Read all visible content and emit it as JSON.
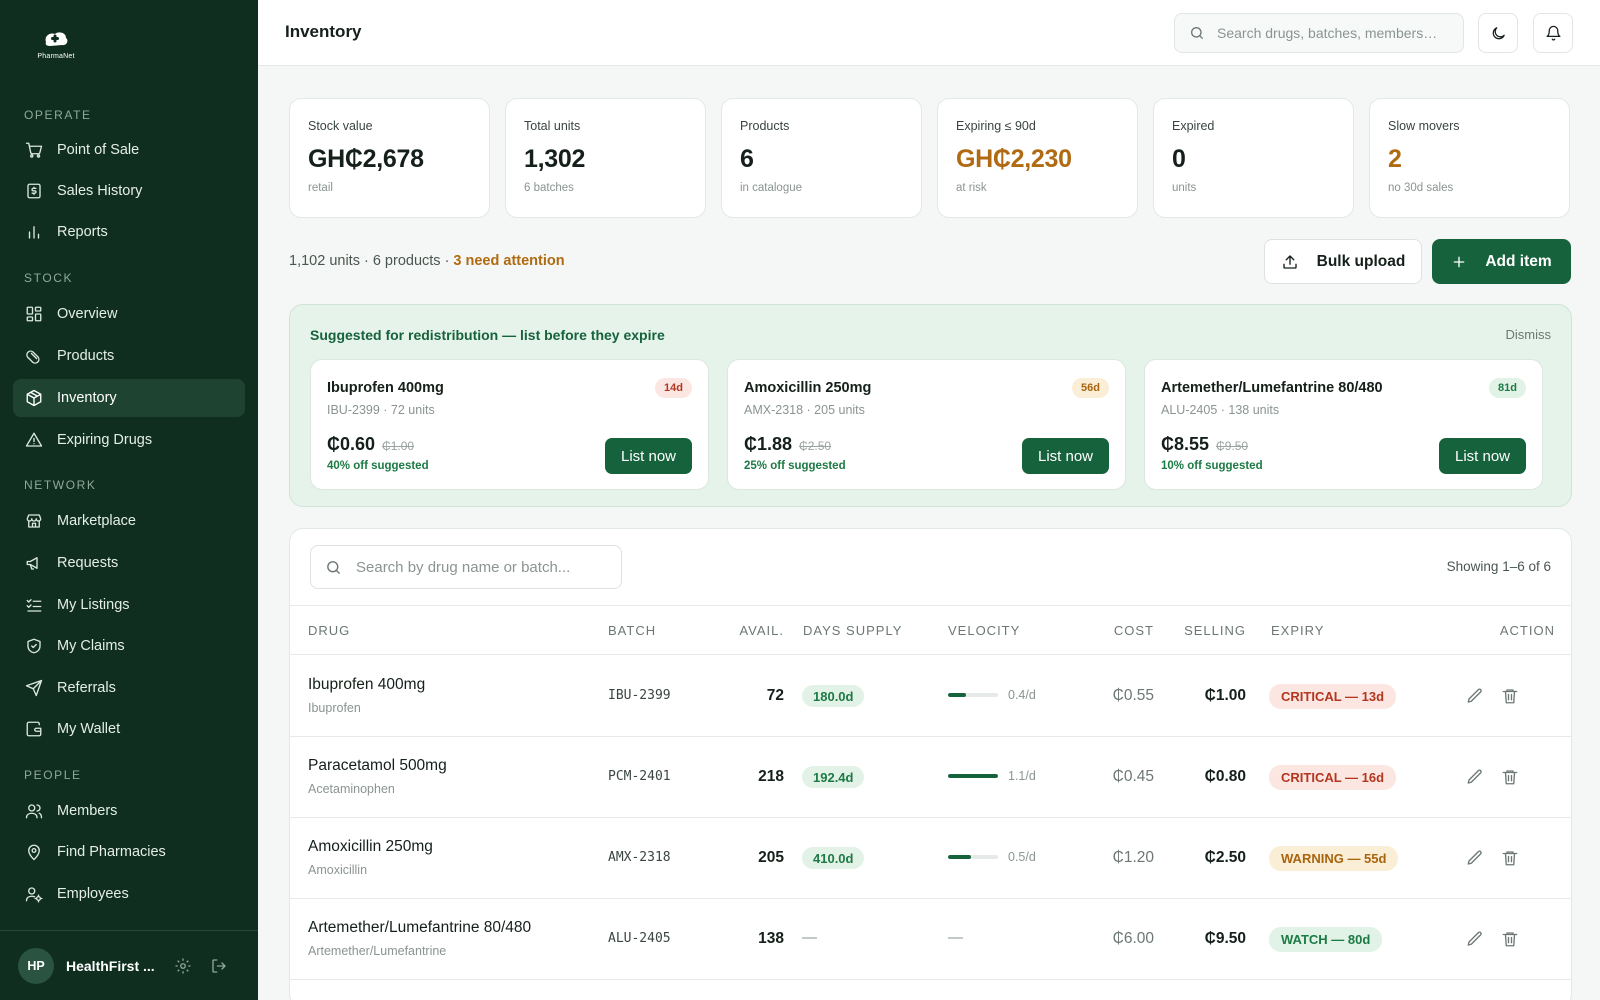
{
  "brand": {
    "name": "PharmaNet"
  },
  "sidebar": {
    "sections": {
      "operate": "OPERATE",
      "stock": "STOCK",
      "network": "NETWORK",
      "people": "PEOPLE"
    },
    "items": [
      {
        "label": "Point of Sale",
        "icon": "cart-icon"
      },
      {
        "label": "Sales History",
        "icon": "receipt-icon"
      },
      {
        "label": "Reports",
        "icon": "bar-chart-icon"
      },
      {
        "label": "Overview",
        "icon": "grid-icon"
      },
      {
        "label": "Products",
        "icon": "pill-icon"
      },
      {
        "label": "Inventory",
        "icon": "box-icon",
        "active": true
      },
      {
        "label": "Expiring Drugs",
        "icon": "warning-icon"
      },
      {
        "label": "Marketplace",
        "icon": "store-icon"
      },
      {
        "label": "Requests",
        "icon": "megaphone-icon"
      },
      {
        "label": "My Listings",
        "icon": "checklist-icon"
      },
      {
        "label": "My Claims",
        "icon": "shield-icon"
      },
      {
        "label": "Referrals",
        "icon": "send-icon"
      },
      {
        "label": "My Wallet",
        "icon": "wallet-icon"
      },
      {
        "label": "Members",
        "icon": "users-icon"
      },
      {
        "label": "Find Pharmacies",
        "icon": "map-pin-icon"
      },
      {
        "label": "Employees",
        "icon": "user-cog-icon"
      }
    ],
    "footer": {
      "initials": "HP",
      "org": "HealthFirst ..."
    }
  },
  "header": {
    "title": "Inventory",
    "search_placeholder": "Search drugs, batches, members…"
  },
  "stats": [
    {
      "label": "Stock value",
      "value": "GH₵2,678",
      "sub": "retail",
      "warn": false
    },
    {
      "label": "Total units",
      "value": "1,302",
      "sub": "6 batches",
      "warn": false
    },
    {
      "label": "Products",
      "value": "6",
      "sub": "in catalogue",
      "warn": false
    },
    {
      "label": "Expiring ≤ 90d",
      "value": "GH₵2,230",
      "sub": "at risk",
      "warn": true
    },
    {
      "label": "Expired",
      "value": "0",
      "sub": "units",
      "warn": false
    },
    {
      "label": "Slow movers",
      "value": "2",
      "sub": "no 30d sales",
      "warn": true
    }
  ],
  "summary": {
    "text": "1,102 units · 6 products · ",
    "attention": "3 need attention"
  },
  "actions": {
    "bulk_upload": "Bulk upload",
    "add_item": "Add item"
  },
  "redistribution": {
    "title": "Suggested for redistribution — list before they expire",
    "dismiss": "Dismiss",
    "cards": [
      {
        "name": "Ibuprofen 400mg",
        "meta": "IBU-2399 · 72 units",
        "badge": "14d",
        "tone": "red",
        "price": "₵0.60",
        "was": "₵1.00",
        "off": "40% off suggested",
        "button": "List now"
      },
      {
        "name": "Amoxicillin 250mg",
        "meta": "AMX-2318 · 205 units",
        "badge": "56d",
        "tone": "amber",
        "price": "₵1.88",
        "was": "₵2.50",
        "off": "25% off suggested",
        "button": "List now"
      },
      {
        "name": "Artemether/Lumefantrine 80/480",
        "meta": "ALU-2405 · 138 units",
        "badge": "81d",
        "tone": "green",
        "price": "₵8.55",
        "was": "₵9.50",
        "off": "10% off suggested",
        "button": "List now"
      }
    ]
  },
  "table": {
    "search_placeholder": "Search by drug name or batch...",
    "showing": "Showing 1–6 of 6",
    "columns": {
      "drug": "DRUG",
      "batch": "BATCH",
      "avail": "AVAIL.",
      "supply": "DAYS SUPPLY",
      "velocity": "VELOCITY",
      "cost": "COST",
      "selling": "SELLING",
      "expiry": "EXPIRY",
      "action": "ACTION"
    },
    "rows": [
      {
        "name": "Ibuprofen 400mg",
        "generic": "Ibuprofen",
        "batch": "IBU-2399",
        "avail": "72",
        "supply": "180.0d",
        "velocity": "0.4/d",
        "velocity_level": 0.35,
        "cost": "₵0.55",
        "selling": "₵1.00",
        "expiry": "CRITICAL — 13d",
        "expiry_tone": "critical"
      },
      {
        "name": "Paracetamol 500mg",
        "generic": "Acetaminophen",
        "batch": "PCM-2401",
        "avail": "218",
        "supply": "192.4d",
        "velocity": "1.1/d",
        "velocity_level": 1.0,
        "cost": "₵0.45",
        "selling": "₵0.80",
        "expiry": "CRITICAL — 16d",
        "expiry_tone": "critical"
      },
      {
        "name": "Amoxicillin 250mg",
        "generic": "Amoxicillin",
        "batch": "AMX-2318",
        "avail": "205",
        "supply": "410.0d",
        "velocity": "0.5/d",
        "velocity_level": 0.45,
        "cost": "₵1.20",
        "selling": "₵2.50",
        "expiry": "WARNING — 55d",
        "expiry_tone": "warning"
      },
      {
        "name": "Artemether/Lumefantrine 80/480",
        "generic": "Artemether/Lumefantrine",
        "batch": "ALU-2405",
        "avail": "138",
        "supply": "—",
        "velocity": "—",
        "velocity_level": 0,
        "cost": "₵6.00",
        "selling": "₵9.50",
        "expiry": "WATCH — 80d",
        "expiry_tone": "watch"
      }
    ]
  }
}
